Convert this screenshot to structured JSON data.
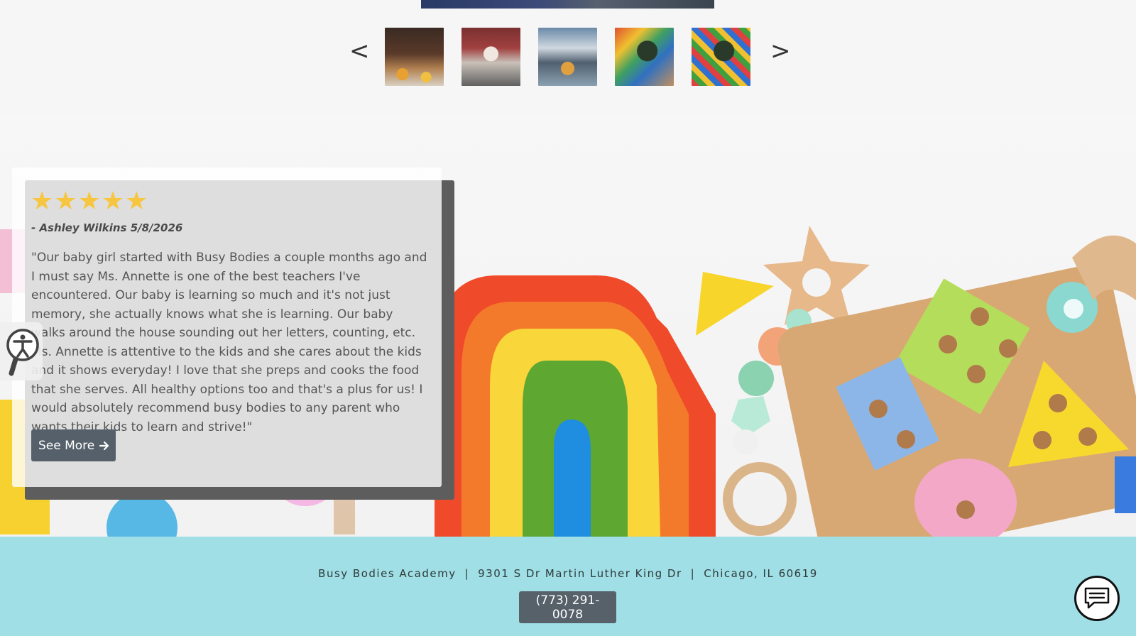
{
  "gallery": {
    "prev_label": "<",
    "next_label": ">",
    "thumbnails": [
      "thumbnail-1",
      "thumbnail-2",
      "thumbnail-3",
      "thumbnail-4",
      "thumbnail-5"
    ]
  },
  "review": {
    "rating": 5,
    "stars": "★★★★★",
    "reviewer": "- Ashley Wilkins 5/8/2026",
    "text": "\"Our baby girl started with Busy Bodies a couple months ago and I must say Ms. Annette is one of the best teachers I've encountered. Our baby is learning so much and it's not just memory, she actually knows what she is learning. Our baby walks around the house sounding out her letters, counting, etc. Ms. Annette is attentive to the kids and she cares about the kids and it shows everyday! I love that she preps and cooks the food that she serves. All healthy options too and that's a plus for us! I would absolutely recommend busy bodies to any parent who wants their kids to learn and strive!\"",
    "see_more_label": "See More"
  },
  "footer": {
    "name": "Busy Bodies Academy",
    "street": "9301 S Dr Martin Luther King Dr",
    "city": "Chicago, IL 60619",
    "separator": "|",
    "phone": "(773) 291-0078"
  },
  "icons": {
    "accessibility": "accessibility-icon",
    "chat": "chat-icon",
    "arrow": "arrow-right-icon"
  },
  "colors": {
    "star": "#f7c641",
    "footer_bg": "#9fdfe5",
    "button_bg": "#56616a"
  }
}
